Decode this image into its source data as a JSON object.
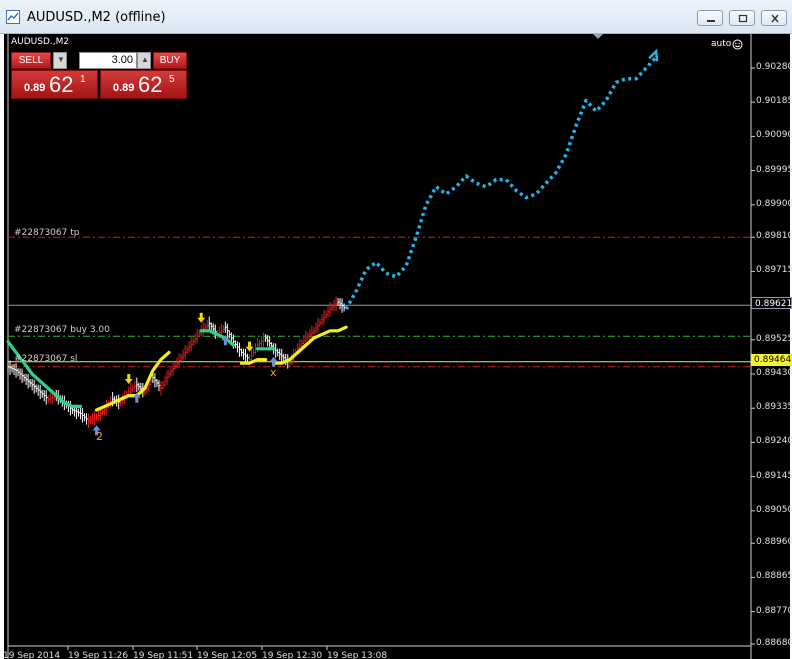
{
  "window": {
    "title": "AUDUSD.,M2 (offline)",
    "icons": [
      "chart-app-icon",
      "minimize-icon",
      "restore-icon",
      "close-icon"
    ]
  },
  "chart": {
    "symbol_label": "AUDUSD.,M2",
    "auto_label": "auto",
    "background": "#000000"
  },
  "trade_panel": {
    "sell_label": "SELL",
    "buy_label": "BUY",
    "volume": "3.00",
    "sell_price": {
      "prefix": "0.89",
      "big": "62",
      "sup": "1"
    },
    "buy_price": {
      "prefix": "0.89",
      "big": "62",
      "sup": "5"
    }
  },
  "levels": {
    "tp_label": "#22873067 tp",
    "buy_label": "#22873067 buy 3.00",
    "sl_label": "#22873067 sl",
    "current_price": "0.89621",
    "line_price": "0.89464"
  },
  "markers": {
    "two": "2",
    "x": "x"
  },
  "colors": {
    "candle_up": "#e02020",
    "candle_down": "#ffffff",
    "ma_green": "#2ad48a",
    "ma_yellow": "#f2f01a",
    "forecast": "#22b4ea",
    "tp_line": "#d01e1e",
    "buy_line": "#2fb12f",
    "sl_line": "#d01e1e",
    "current_line": "#8a9bb5",
    "yellow_line": "#f6f32a",
    "arrow_up": "#6f8fd6",
    "arrow_down": "#f6d40a"
  },
  "chart_data": {
    "type": "line",
    "price_axis": [
      "0.90280",
      "0.90185",
      "0.90090",
      "0.89995",
      "0.89900",
      "0.89810",
      "0.89715",
      "0.89621",
      "0.89525",
      "0.89464",
      "0.89430",
      "0.89335",
      "0.89240",
      "0.89145",
      "0.89050",
      "0.88960",
      "0.88865",
      "0.88770",
      "0.88680"
    ],
    "time_axis": [
      "19 Sep 2014",
      "19 Sep 11:26",
      "19 Sep 11:51",
      "19 Sep 12:05",
      "19 Sep 12:30",
      "19 Sep 13:08"
    ],
    "ylim": [
      0.8868,
      0.9028
    ],
    "tp_level": 0.8981,
    "buy_level": 0.89535,
    "sl_level": 0.8945,
    "current_level": 0.89621,
    "yellow_level": 0.89464,
    "price_series": [
      0.8945,
      0.8944,
      0.8942,
      0.894,
      0.8938,
      0.8936,
      0.8937,
      0.8935,
      0.8933,
      0.8932,
      0.893,
      0.8931,
      0.8933,
      0.8936,
      0.8935,
      0.8938,
      0.894,
      0.8938,
      0.8942,
      0.8939,
      0.8943,
      0.8946,
      0.8949,
      0.8952,
      0.8955,
      0.8957,
      0.8954,
      0.8956,
      0.8952,
      0.8949,
      0.8947,
      0.8951,
      0.8953,
      0.895,
      0.8948,
      0.8946,
      0.895,
      0.8953,
      0.8955,
      0.8958,
      0.8961,
      0.8963,
      0.8961
    ],
    "green_ma": [
      {
        "x": 0,
        "values": [
          0.8952,
          0.8949,
          0.8946,
          0.8943,
          0.8941,
          0.8939,
          0.8937,
          0.8935,
          0.8934,
          0.8934
        ]
      },
      {
        "x": 24,
        "values": [
          0.8955,
          0.8955,
          0.8954,
          0.8953,
          0.8951
        ]
      },
      {
        "x": 31,
        "values": [
          0.895,
          0.895,
          0.895
        ]
      }
    ],
    "yellow_ma": [
      {
        "x": 11,
        "values": [
          0.8933,
          0.8934,
          0.8935,
          0.8936,
          0.8937,
          0.8937,
          0.8939,
          0.8944,
          0.8947,
          0.8949
        ]
      },
      {
        "x": 29,
        "values": [
          0.8946,
          0.8946,
          0.8947,
          0.8947
        ]
      },
      {
        "x": 33,
        "values": [
          0.8946,
          0.8946,
          0.8947,
          0.8949,
          0.8951,
          0.8953,
          0.8954,
          0.8955,
          0.8955,
          0.8956
        ]
      }
    ],
    "forecast": [
      0.8961,
      0.8966,
      0.8972,
      0.8974,
      0.8971,
      0.897,
      0.8973,
      0.8981,
      0.899,
      0.8995,
      0.8993,
      0.8995,
      0.8998,
      0.8996,
      0.8995,
      0.8997,
      0.8997,
      0.8994,
      0.8992,
      0.8993,
      0.8996,
      0.8999,
      0.9004,
      0.9012,
      0.9019,
      0.9016,
      0.9019,
      0.9024,
      0.9025,
      0.9025,
      0.9028,
      0.9031
    ],
    "up_arrows": [
      11,
      16,
      27,
      33
    ],
    "down_arrows": [
      15,
      24,
      30
    ]
  }
}
